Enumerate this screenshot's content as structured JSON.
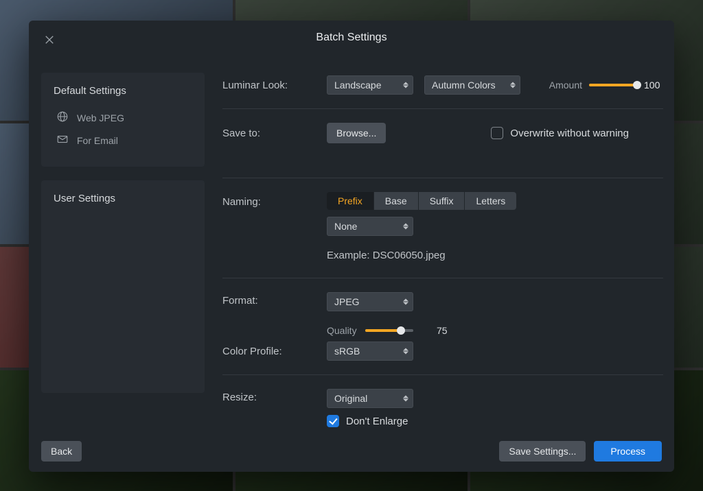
{
  "modal": {
    "title": "Batch Settings",
    "back": "Back",
    "save_settings": "Save Settings...",
    "process": "Process"
  },
  "sidebar": {
    "default_title": "Default Settings",
    "user_title": "User Settings",
    "presets": [
      {
        "icon": "globe",
        "label": "Web JPEG"
      },
      {
        "icon": "mail",
        "label": "For Email"
      }
    ]
  },
  "look": {
    "label": "Luminar Look:",
    "preset": "Landscape",
    "color": "Autumn Colors",
    "amount_label": "Amount",
    "amount_value": "100"
  },
  "save": {
    "label": "Save to:",
    "browse": "Browse...",
    "overwrite": "Overwrite without warning",
    "overwrite_checked": false
  },
  "naming": {
    "label": "Naming:",
    "tabs": [
      "Prefix",
      "Base",
      "Suffix",
      "Letters"
    ],
    "active_tab": 0,
    "option": "None",
    "example_label": "Example: DSC06050.jpeg"
  },
  "format": {
    "label": "Format:",
    "value": "JPEG",
    "quality_label": "Quality",
    "quality_value": "75",
    "color_profile_label": "Color Profile:",
    "color_profile_value": "sRGB"
  },
  "resize": {
    "label": "Resize:",
    "value": "Original",
    "dont_enlarge": "Don't Enlarge",
    "dont_enlarge_checked": true
  }
}
